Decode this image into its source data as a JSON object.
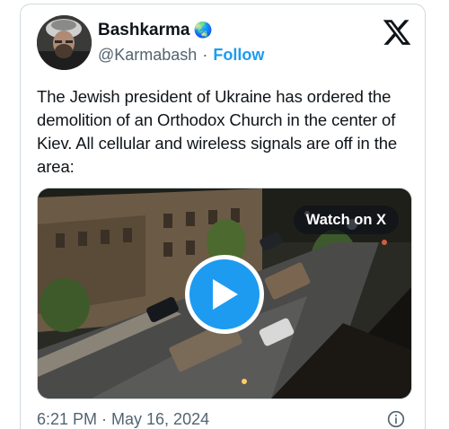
{
  "tweet": {
    "display_name": "Bashkarma",
    "name_emoji": "🌏",
    "handle": "@Karmabash",
    "separator": "·",
    "follow_label": "Follow",
    "text": "The Jewish president of Ukraine has ordered the demolition of an Orthodox Church in the center of Kiev. All cellular and wireless signals are off in the area:",
    "timestamp": "6:21 PM · May 16, 2024"
  },
  "media": {
    "watch_label": "Watch on X"
  },
  "icons": {
    "brand": "x-logo-icon",
    "play": "play-icon",
    "info": "info-icon"
  },
  "colors": {
    "accent": "#1d9bf0",
    "text": "#0f1419",
    "muted": "#536471",
    "border": "#cfd9de"
  }
}
